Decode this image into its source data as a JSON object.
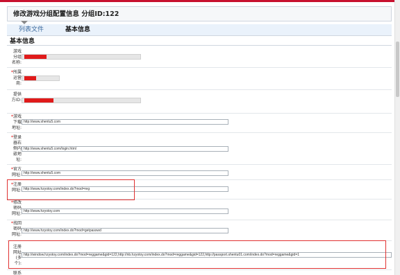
{
  "page": {
    "title_label": "修改游戏分组配置信息",
    "group_id_label": "分组ID:122"
  },
  "tabs": [
    {
      "label": "列表文件"
    },
    {
      "label": "基本信息"
    }
  ],
  "section_title": "基本信息",
  "fields": [
    {
      "label": "游戏\n分组\n名称:",
      "value": ""
    },
    {
      "label": "所属\n运营\n商:",
      "value": ""
    },
    {
      "label": "提供\n方ID:",
      "value": ""
    },
    {
      "label": "游戏\n下载\n地址:",
      "value": "http://www.shentu5.com"
    },
    {
      "label": "登录\n器右\n侧内\n嵌地\n址:",
      "value": "http://www.shentu5.com/login.html"
    },
    {
      "label": "官方\n网址:",
      "value": "http://www.shentu5.com"
    },
    {
      "label": "注册\n网址:",
      "value": "http://www.hzyotoy.com/index.do?mod=reg"
    },
    {
      "label": "修改\n密码\n网址:",
      "value": "http://www.hzyotoy.com"
    },
    {
      "label": "找回\n密码\n网址:",
      "value": "http://www.hzyotoy.com/index.do?mod=getpasswd"
    },
    {
      "label": "注册\n网址\n(多\n个):",
      "value": "http://window.hzyotoy.com/index.do?mod=reggame&gid=122,http://nb.hzyotoy.com/index.do?mod=reggame&gid=122,http://passport.shentu01.com/index.do?mod=reggame&gid=1"
    },
    {
      "label": "联系",
      "value": ""
    }
  ],
  "colors": {
    "accent_red": "#c8102e",
    "tab_link": "#3c6a9e",
    "highlight_box": "#e03030"
  }
}
